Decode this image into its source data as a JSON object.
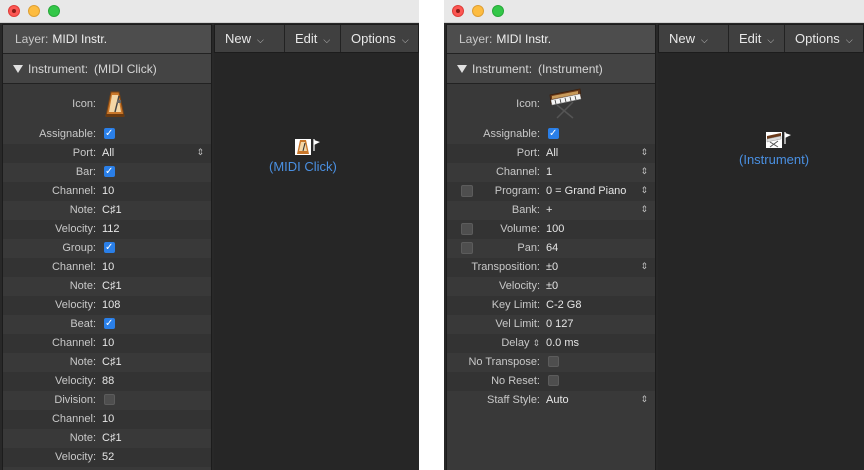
{
  "left": {
    "layer_label": "Layer:",
    "layer_value": "MIDI Instr.",
    "section_label": "Instrument:",
    "section_value": "(MIDI Click)",
    "icon_label": "Icon:",
    "rows": [
      {
        "label": "Assignable:",
        "kind": "checkbox",
        "checked": true
      },
      {
        "label": "Port:",
        "value": "All",
        "stepper": true
      },
      {
        "label": "Bar:",
        "kind": "checkbox",
        "checked": true
      },
      {
        "label": "Channel:",
        "value": "10"
      },
      {
        "label": "Note:",
        "value": "C♯1"
      },
      {
        "label": "Velocity:",
        "value": "112"
      },
      {
        "label": "Group:",
        "kind": "checkbox",
        "checked": true
      },
      {
        "label": "Channel:",
        "value": "10"
      },
      {
        "label": "Note:",
        "value": "C♯1"
      },
      {
        "label": "Velocity:",
        "value": "108"
      },
      {
        "label": "Beat:",
        "kind": "checkbox",
        "checked": true
      },
      {
        "label": "Channel:",
        "value": "10"
      },
      {
        "label": "Note:",
        "value": "C♯1"
      },
      {
        "label": "Velocity:",
        "value": "88"
      },
      {
        "label": "Division:",
        "kind": "checkbox",
        "checked": false
      },
      {
        "label": "Channel:",
        "value": "10"
      },
      {
        "label": "Note:",
        "value": "C♯1"
      },
      {
        "label": "Velocity:",
        "value": "52"
      }
    ],
    "menus": {
      "new": "New",
      "edit": "Edit",
      "options": "Options"
    },
    "object_label": "(MIDI Click)"
  },
  "right": {
    "layer_label": "Layer:",
    "layer_value": "MIDI Instr.",
    "section_label": "Instrument:",
    "section_value": "(Instrument)",
    "icon_label": "Icon:",
    "rows": [
      {
        "label": "Assignable:",
        "kind": "checkbox",
        "checked": true
      },
      {
        "label": "Port:",
        "value": "All",
        "stepper": true
      },
      {
        "label": "Channel:",
        "value": "1",
        "stepper": true
      },
      {
        "label": "Program:",
        "value": "0 = Grand Piano",
        "stepper": true,
        "left_checkbox": true
      },
      {
        "label": "Bank:",
        "value": "+",
        "stepper": true
      },
      {
        "label": "Volume:",
        "value": "100",
        "left_checkbox": true
      },
      {
        "label": "Pan:",
        "value": "64",
        "left_checkbox": true
      },
      {
        "label": "Transposition:",
        "value": "±0",
        "stepper": true
      },
      {
        "label": "Velocity:",
        "value": "±0"
      },
      {
        "label": "Key Limit:",
        "value": "C-2     G8"
      },
      {
        "label": "Vel Limit:",
        "value": "0     127"
      },
      {
        "label": "Delay",
        "value": "0.0 ms",
        "label_stepper": true
      },
      {
        "label": "No Transpose:",
        "kind": "checkbox",
        "checked": false
      },
      {
        "label": "No Reset:",
        "kind": "checkbox",
        "checked": false
      },
      {
        "label": "Staff Style:",
        "value": "Auto",
        "stepper": true
      }
    ],
    "menus": {
      "new": "New",
      "edit": "Edit",
      "options": "Options"
    },
    "object_label": "(Instrument)"
  },
  "icons": {
    "metronome": "metronome-icon",
    "keyboard": "keyboard-icon",
    "chevron": "chevron-down-icon",
    "stepper": "stepper-icon",
    "flag": "flag-icon"
  }
}
